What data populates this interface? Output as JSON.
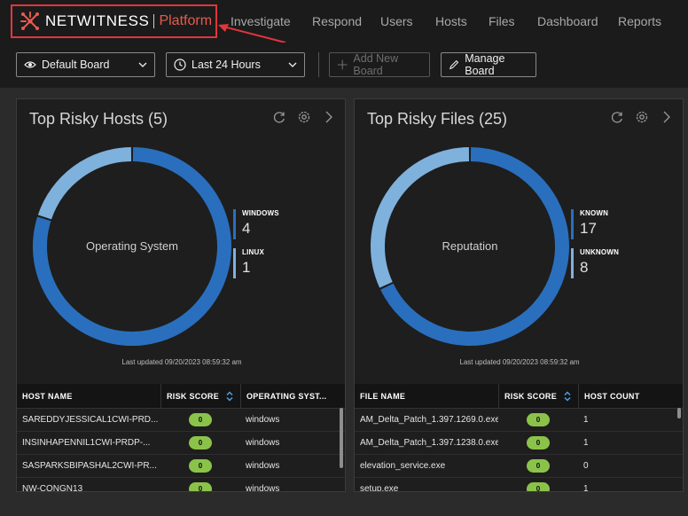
{
  "brand": {
    "name": "NETWITNESS",
    "sub": "Platform"
  },
  "nav": [
    "Investigate",
    "Respond",
    "Users",
    "Hosts",
    "Files",
    "Dashboard",
    "Reports"
  ],
  "toolbar": {
    "board": "Default Board",
    "time_range": "Last 24 Hours",
    "add_board": "Add New Board",
    "manage_board": "Manage Board"
  },
  "colors": {
    "accent": "#e0363c",
    "donut_primary": "#2a6fbd",
    "donut_secondary": "#7fb1dd",
    "pill": "#8bc34a"
  },
  "hosts_panel": {
    "title": "Top Risky Hosts (5)",
    "center_label": "Operating System",
    "legend": [
      {
        "name": "WINDOWS",
        "count": "4"
      },
      {
        "name": "LINUX",
        "count": "1"
      }
    ],
    "last_updated": "Last updated 09/20/2023 08:59:32 am",
    "columns": [
      "HOST NAME",
      "RISK SCORE",
      "OPERATING SYST..."
    ],
    "rows": [
      {
        "name": "SAREDDYJESSICAL1CWI-PRD...",
        "score": "0",
        "extra": "windows"
      },
      {
        "name": "INSINHAPENNIL1CWI-PRDP-...",
        "score": "0",
        "extra": "windows"
      },
      {
        "name": "SASPARKSBIPASHAL2CWI-PR...",
        "score": "0",
        "extra": "windows"
      },
      {
        "name": "NW-CQNGN13",
        "score": "0",
        "extra": "windows"
      }
    ]
  },
  "files_panel": {
    "title": "Top Risky Files (25)",
    "center_label": "Reputation",
    "legend": [
      {
        "name": "KNOWN",
        "count": "17"
      },
      {
        "name": "UNKNOWN",
        "count": "8"
      }
    ],
    "last_updated": "Last updated 09/20/2023 08:59:32 am",
    "columns": [
      "FILE NAME",
      "RISK SCORE",
      "HOST COUNT"
    ],
    "rows": [
      {
        "name": "AM_Delta_Patch_1.397.1269.0.exe",
        "score": "0",
        "extra": "1"
      },
      {
        "name": "AM_Delta_Patch_1.397.1238.0.exe",
        "score": "0",
        "extra": "1"
      },
      {
        "name": "elevation_service.exe",
        "score": "0",
        "extra": "0"
      },
      {
        "name": "setup.exe",
        "score": "0",
        "extra": "1"
      }
    ]
  }
}
